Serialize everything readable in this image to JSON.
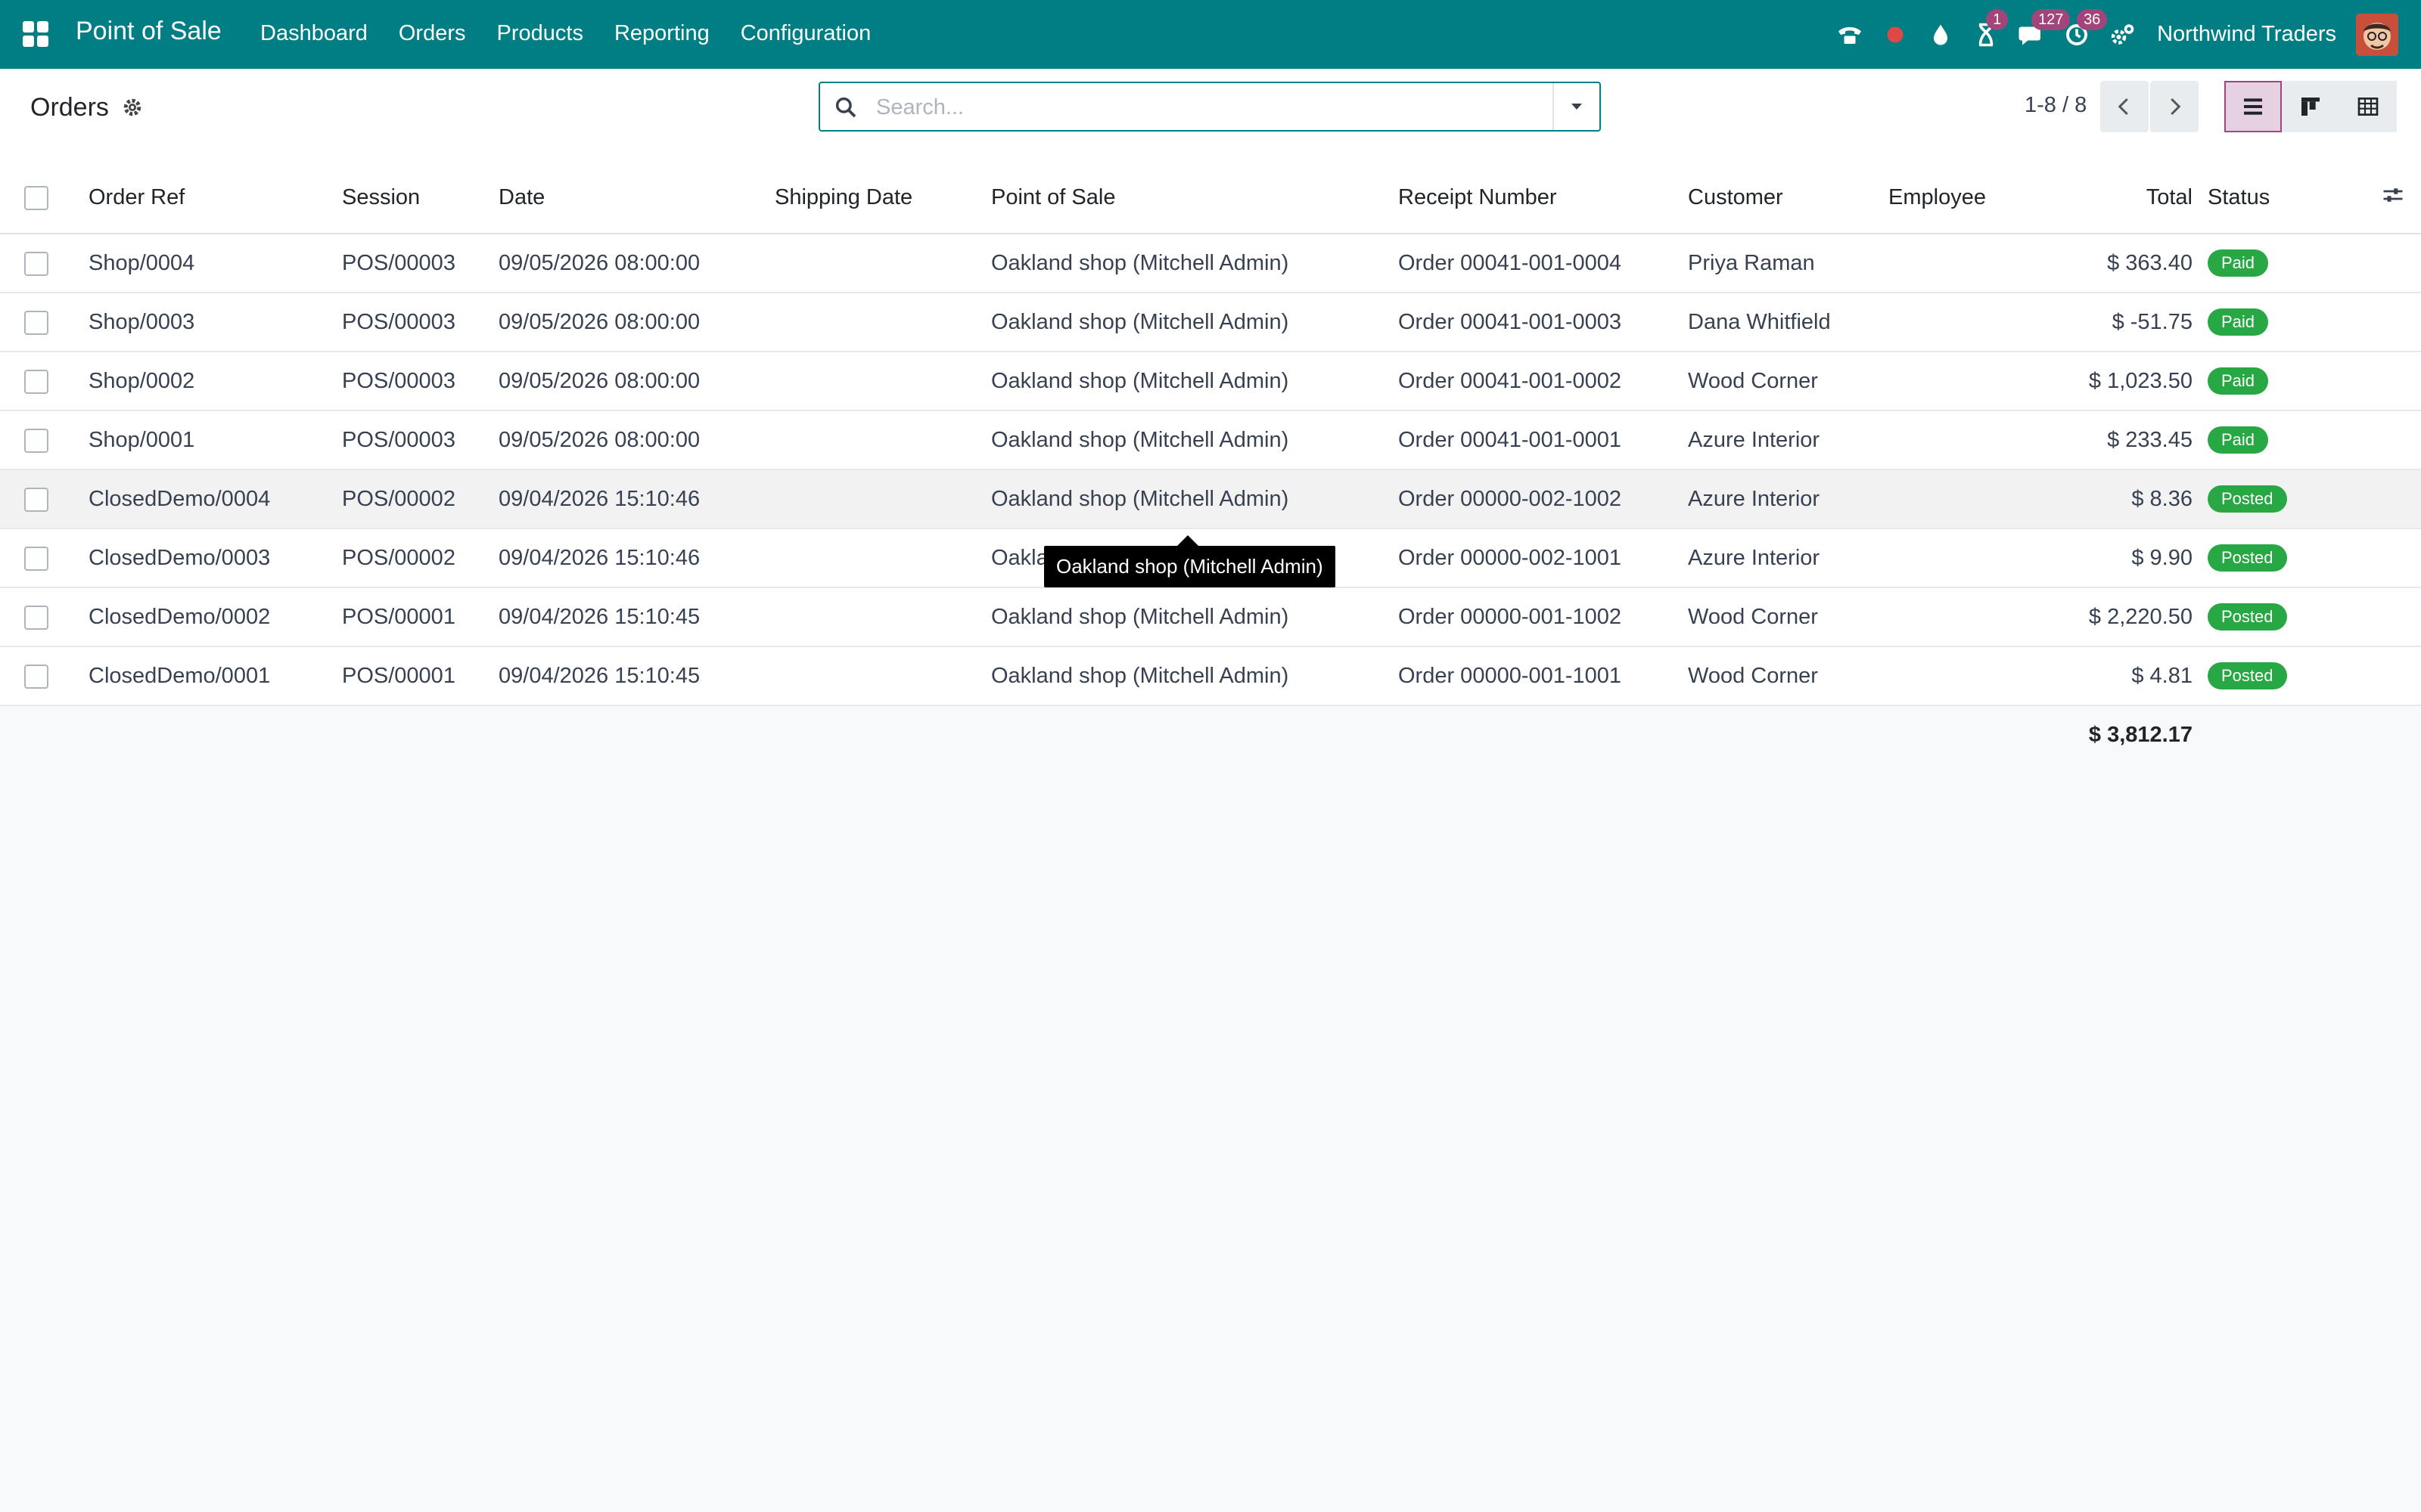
{
  "navbar": {
    "brand": "Point of Sale",
    "menu": [
      "Dashboard",
      "Orders",
      "Products",
      "Reporting",
      "Configuration"
    ],
    "badges": {
      "activities": "1",
      "messages": "127",
      "timesheet": "36"
    },
    "company": "Northwind Traders"
  },
  "control_panel": {
    "title": "Orders",
    "search_placeholder": "Search...",
    "pager": "1-8 / 8"
  },
  "table": {
    "columns": [
      "Order Ref",
      "Session",
      "Date",
      "Shipping Date",
      "Point of Sale",
      "Receipt Number",
      "Customer",
      "Employee",
      "Total",
      "Status"
    ],
    "rows": [
      {
        "ref": "Shop/0004",
        "session": "POS/00003",
        "date": "09/05/2026 08:00:00",
        "shipping": "",
        "pos": "Oakland shop (Mitchell Admin)",
        "receipt": "Order 00041-001-0004",
        "customer": "Priya Raman",
        "employee": "",
        "total": "$ 363.40",
        "status": "Paid"
      },
      {
        "ref": "Shop/0003",
        "session": "POS/00003",
        "date": "09/05/2026 08:00:00",
        "shipping": "",
        "pos": "Oakland shop (Mitchell Admin)",
        "receipt": "Order 00041-001-0003",
        "customer": "Dana Whitfield",
        "employee": "",
        "total": "$ -51.75",
        "status": "Paid"
      },
      {
        "ref": "Shop/0002",
        "session": "POS/00003",
        "date": "09/05/2026 08:00:00",
        "shipping": "",
        "pos": "Oakland shop (Mitchell Admin)",
        "receipt": "Order 00041-001-0002",
        "customer": "Wood Corner",
        "employee": "",
        "total": "$ 1,023.50",
        "status": "Paid"
      },
      {
        "ref": "Shop/0001",
        "session": "POS/00003",
        "date": "09/05/2026 08:00:00",
        "shipping": "",
        "pos": "Oakland shop (Mitchell Admin)",
        "receipt": "Order 00041-001-0001",
        "customer": "Azure Interior",
        "employee": "",
        "total": "$ 233.45",
        "status": "Paid"
      },
      {
        "ref": "ClosedDemo/0004",
        "session": "POS/00002",
        "date": "09/04/2026 15:10:46",
        "shipping": "",
        "pos": "Oakland shop (Mitchell Admin)",
        "receipt": "Order 00000-002-1002",
        "customer": "Azure Interior",
        "employee": "",
        "total": "$ 8.36",
        "status": "Posted"
      },
      {
        "ref": "ClosedDemo/0003",
        "session": "POS/00002",
        "date": "09/04/2026 15:10:46",
        "shipping": "",
        "pos": "Oakland shop (Mitchell Admin)",
        "receipt": "Order 00000-002-1001",
        "customer": "Azure Interior",
        "employee": "",
        "total": "$ 9.90",
        "status": "Posted"
      },
      {
        "ref": "ClosedDemo/0002",
        "session": "POS/00001",
        "date": "09/04/2026 15:10:45",
        "shipping": "",
        "pos": "Oakland shop (Mitchell Admin)",
        "receipt": "Order 00000-001-1002",
        "customer": "Wood Corner",
        "employee": "",
        "total": "$ 2,220.50",
        "status": "Posted"
      },
      {
        "ref": "ClosedDemo/0001",
        "session": "POS/00001",
        "date": "09/04/2026 15:10:45",
        "shipping": "",
        "pos": "Oakland shop (Mitchell Admin)",
        "receipt": "Order 00000-001-1001",
        "customer": "Wood Corner",
        "employee": "",
        "total": "$ 4.81",
        "status": "Posted"
      }
    ],
    "sum_total": "$ 3,812.17"
  },
  "tooltip": "Oakland shop (Mitchell Admin)",
  "colors": {
    "navbar": "#017e84",
    "badge": "#a2457a",
    "status_green": "#28a745"
  }
}
